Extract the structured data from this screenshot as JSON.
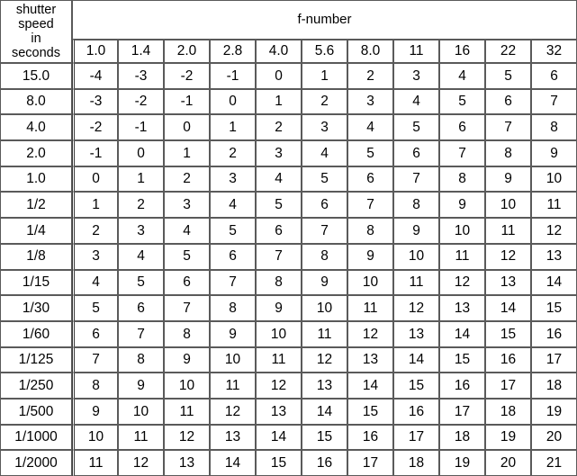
{
  "table": {
    "stub_header": {
      "name": "shutter-speed-header",
      "lines": [
        "shutter",
        "speed",
        "in",
        "seconds"
      ],
      "full_text": "shutter speed in seconds"
    },
    "column_group_header": "f-number",
    "column_headers": [
      "1.0",
      "1.4",
      "2.0",
      "2.8",
      "4.0",
      "5.6",
      "8.0",
      "11",
      "16",
      "22",
      "32"
    ],
    "row_headers": [
      "15.0",
      "8.0",
      "4.0",
      "2.0",
      "1.0",
      "1/2",
      "1/4",
      "1/8",
      "1/15",
      "1/30",
      "1/60",
      "1/125",
      "1/250",
      "1/500",
      "1/1000",
      "1/2000"
    ],
    "rows": [
      [
        "-4",
        "-3",
        "-2",
        "-1",
        "0",
        "1",
        "2",
        "3",
        "4",
        "5",
        "6"
      ],
      [
        "-3",
        "-2",
        "-1",
        "0",
        "1",
        "2",
        "3",
        "4",
        "5",
        "6",
        "7"
      ],
      [
        "-2",
        "-1",
        "0",
        "1",
        "2",
        "3",
        "4",
        "5",
        "6",
        "7",
        "8"
      ],
      [
        "-1",
        "0",
        "1",
        "2",
        "3",
        "4",
        "5",
        "6",
        "7",
        "8",
        "9"
      ],
      [
        "0",
        "1",
        "2",
        "3",
        "4",
        "5",
        "6",
        "7",
        "8",
        "9",
        "10"
      ],
      [
        "1",
        "2",
        "3",
        "4",
        "5",
        "6",
        "7",
        "8",
        "9",
        "10",
        "11"
      ],
      [
        "2",
        "3",
        "4",
        "5",
        "6",
        "7",
        "8",
        "9",
        "10",
        "11",
        "12"
      ],
      [
        "3",
        "4",
        "5",
        "6",
        "7",
        "8",
        "9",
        "10",
        "11",
        "12",
        "13"
      ],
      [
        "4",
        "5",
        "6",
        "7",
        "8",
        "9",
        "10",
        "11",
        "12",
        "13",
        "14"
      ],
      [
        "5",
        "6",
        "7",
        "8",
        "9",
        "10",
        "11",
        "12",
        "13",
        "14",
        "15"
      ],
      [
        "6",
        "7",
        "8",
        "9",
        "10",
        "11",
        "12",
        "13",
        "14",
        "15",
        "16"
      ],
      [
        "7",
        "8",
        "9",
        "10",
        "11",
        "12",
        "13",
        "14",
        "15",
        "16",
        "17"
      ],
      [
        "8",
        "9",
        "10",
        "11",
        "12",
        "13",
        "14",
        "15",
        "16",
        "17",
        "18"
      ],
      [
        "9",
        "10",
        "11",
        "12",
        "13",
        "14",
        "15",
        "16",
        "17",
        "18",
        "19"
      ],
      [
        "10",
        "11",
        "12",
        "13",
        "14",
        "15",
        "16",
        "17",
        "18",
        "19",
        "20"
      ],
      [
        "11",
        "12",
        "13",
        "14",
        "15",
        "16",
        "17",
        "18",
        "19",
        "20",
        "21"
      ]
    ]
  },
  "chart_data": {
    "type": "table",
    "title": "",
    "xlabel": "f-number",
    "ylabel": "shutter speed in seconds",
    "categories": [
      "1.0",
      "1.4",
      "2.0",
      "2.8",
      "4.0",
      "5.6",
      "8.0",
      "11",
      "16",
      "22",
      "32"
    ],
    "row_categories": [
      "15.0",
      "8.0",
      "4.0",
      "2.0",
      "1.0",
      "1/2",
      "1/4",
      "1/8",
      "1/15",
      "1/30",
      "1/60",
      "1/125",
      "1/250",
      "1/500",
      "1/1000",
      "1/2000"
    ],
    "values": [
      [
        -4,
        -3,
        -2,
        -1,
        0,
        1,
        2,
        3,
        4,
        5,
        6
      ],
      [
        -3,
        -2,
        -1,
        0,
        1,
        2,
        3,
        4,
        5,
        6,
        7
      ],
      [
        -2,
        -1,
        0,
        1,
        2,
        3,
        4,
        5,
        6,
        7,
        8
      ],
      [
        -1,
        0,
        1,
        2,
        3,
        4,
        5,
        6,
        7,
        8,
        9
      ],
      [
        0,
        1,
        2,
        3,
        4,
        5,
        6,
        7,
        8,
        9,
        10
      ],
      [
        1,
        2,
        3,
        4,
        5,
        6,
        7,
        8,
        9,
        10,
        11
      ],
      [
        2,
        3,
        4,
        5,
        6,
        7,
        8,
        9,
        10,
        11,
        12
      ],
      [
        3,
        4,
        5,
        6,
        7,
        8,
        9,
        10,
        11,
        12,
        13
      ],
      [
        4,
        5,
        6,
        7,
        8,
        9,
        10,
        11,
        12,
        13,
        14
      ],
      [
        5,
        6,
        7,
        8,
        9,
        10,
        11,
        12,
        13,
        14,
        15
      ],
      [
        6,
        7,
        8,
        9,
        10,
        11,
        12,
        13,
        14,
        15,
        16
      ],
      [
        7,
        8,
        9,
        10,
        11,
        12,
        13,
        14,
        15,
        16,
        17
      ],
      [
        8,
        9,
        10,
        11,
        12,
        13,
        14,
        15,
        16,
        17,
        18
      ],
      [
        9,
        10,
        11,
        12,
        13,
        14,
        15,
        16,
        17,
        18,
        19
      ],
      [
        10,
        11,
        12,
        13,
        14,
        15,
        16,
        17,
        18,
        19,
        20
      ],
      [
        11,
        12,
        13,
        14,
        15,
        16,
        17,
        18,
        19,
        20,
        21
      ]
    ],
    "zlim": [
      -4,
      21
    ],
    "grid": true,
    "legend": "none"
  },
  "colors": {
    "text": "#000000",
    "border": "#5a5a5a",
    "heavy_border": "#3c3c3c",
    "background": "#ffffff"
  }
}
